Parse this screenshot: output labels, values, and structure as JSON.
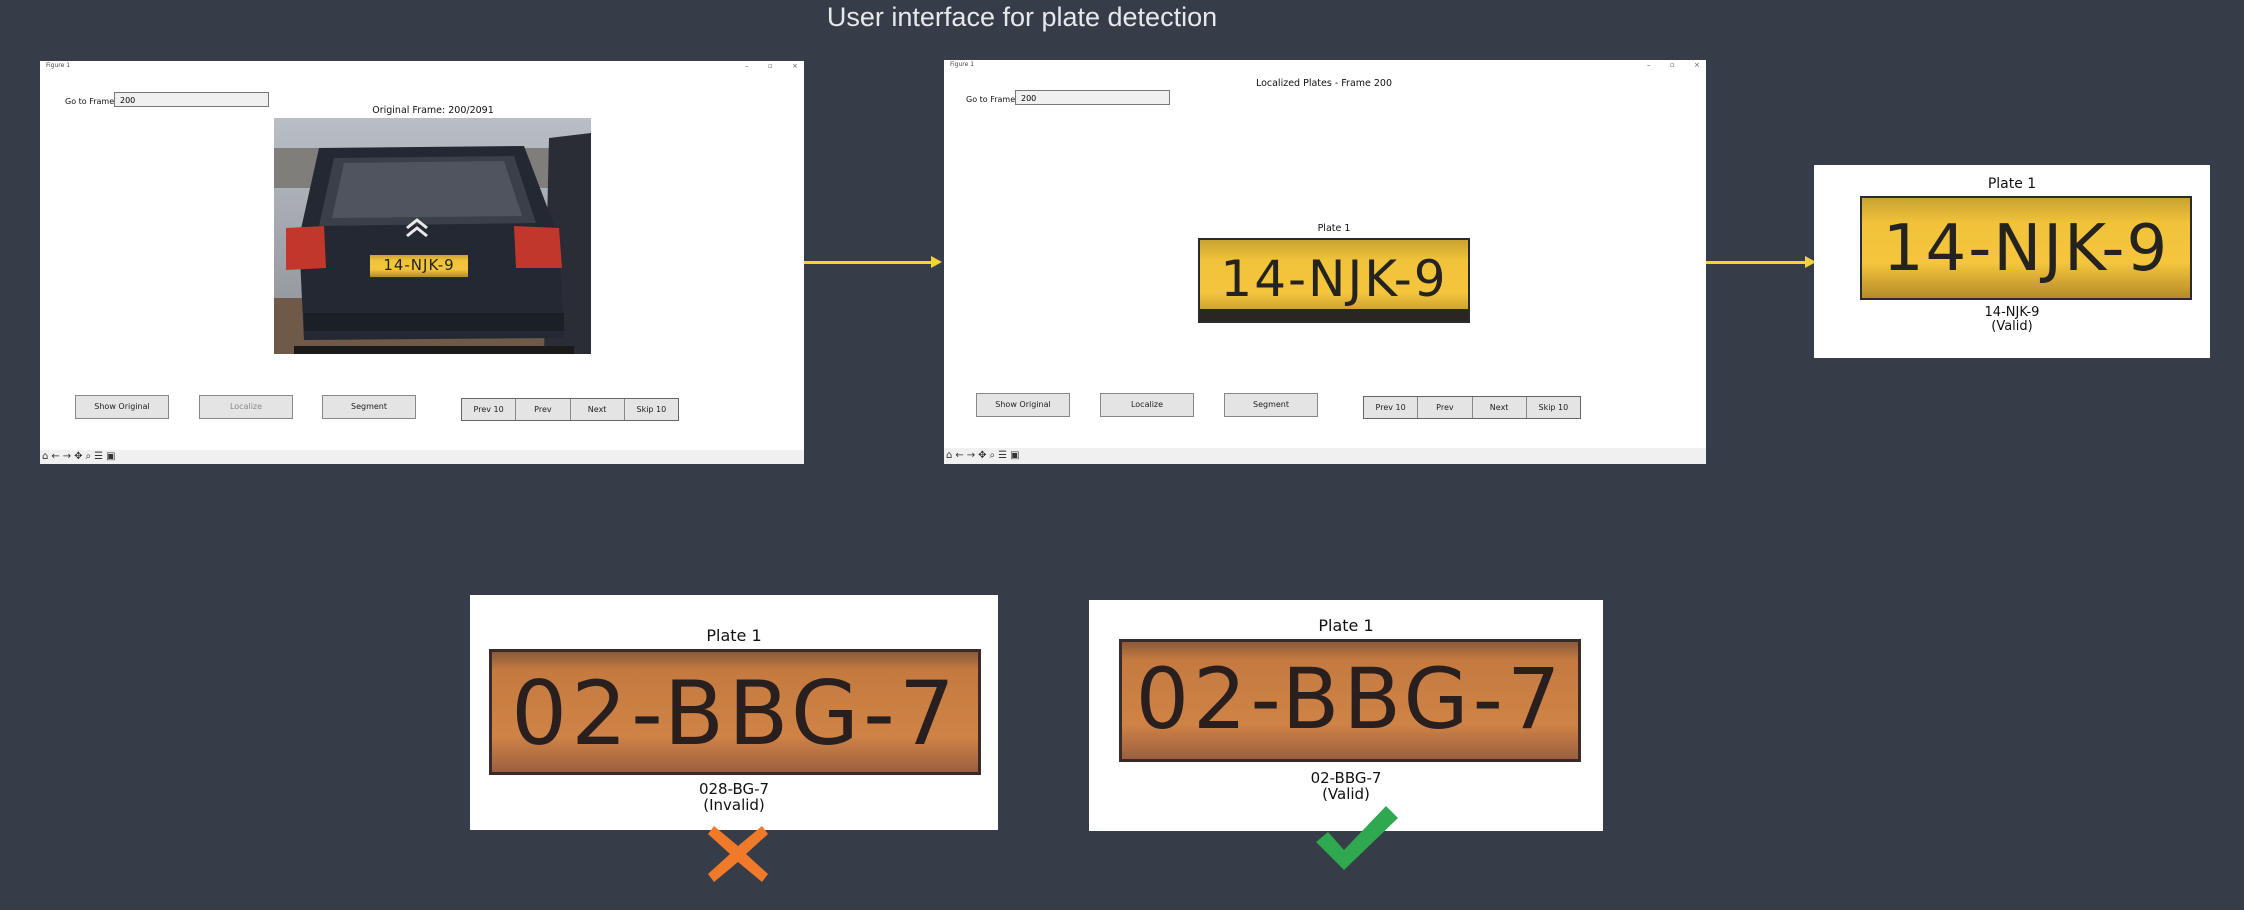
{
  "slide": {
    "title": "User interface for plate detection"
  },
  "window_left": {
    "title": "Figure 1",
    "goto_label": "Go to Frame:",
    "goto_value": "200",
    "figure_title": "Original Frame: 200/2091",
    "buttons": {
      "show_original": "Show Original",
      "localize": "Localize",
      "segment": "Segment"
    },
    "nav": {
      "prev10": "Prev 10",
      "prev": "Prev",
      "next": "Next",
      "skip10": "Skip 10"
    },
    "car_plate_text": "14-NJK-9"
  },
  "window_right": {
    "title": "Figure 1",
    "goto_label": "Go to Frame:",
    "goto_value": "200",
    "figure_title": "Localized Plates - Frame 200",
    "plate_title": "Plate 1",
    "plate_text": "14-NJK-9",
    "buttons": {
      "show_original": "Show Original",
      "localize": "Localize",
      "segment": "Segment"
    },
    "nav": {
      "prev10": "Prev 10",
      "prev": "Prev",
      "next": "Next",
      "skip10": "Skip 10"
    }
  },
  "result_card": {
    "title": "Plate 1",
    "plate_text": "14-NJK-9",
    "caption_line1": "14-NJK-9",
    "caption_line2": "(Valid)"
  },
  "invalid_card": {
    "title": "Plate 1",
    "plate_text": "02-BBG-7",
    "caption_line1": "028-BG-7",
    "caption_line2": "(Invalid)"
  },
  "valid_card": {
    "title": "Plate 1",
    "plate_text": "02-BBG-7",
    "caption_line1": "02-BBG-7",
    "caption_line2": "(Valid)"
  },
  "colors": {
    "background": "#373d48",
    "arrow": "#f2d33a",
    "plate_yellow": "#f4c53d",
    "plate_orange": "#cf8346",
    "invalid_mark": "#f07a2a",
    "valid_mark": "#2fa84f"
  },
  "icons": [
    "home-icon",
    "back-arrow-icon",
    "forward-arrow-icon",
    "pan-icon",
    "zoom-icon",
    "configure-icon",
    "save-icon",
    "cross-icon",
    "check-icon"
  ]
}
